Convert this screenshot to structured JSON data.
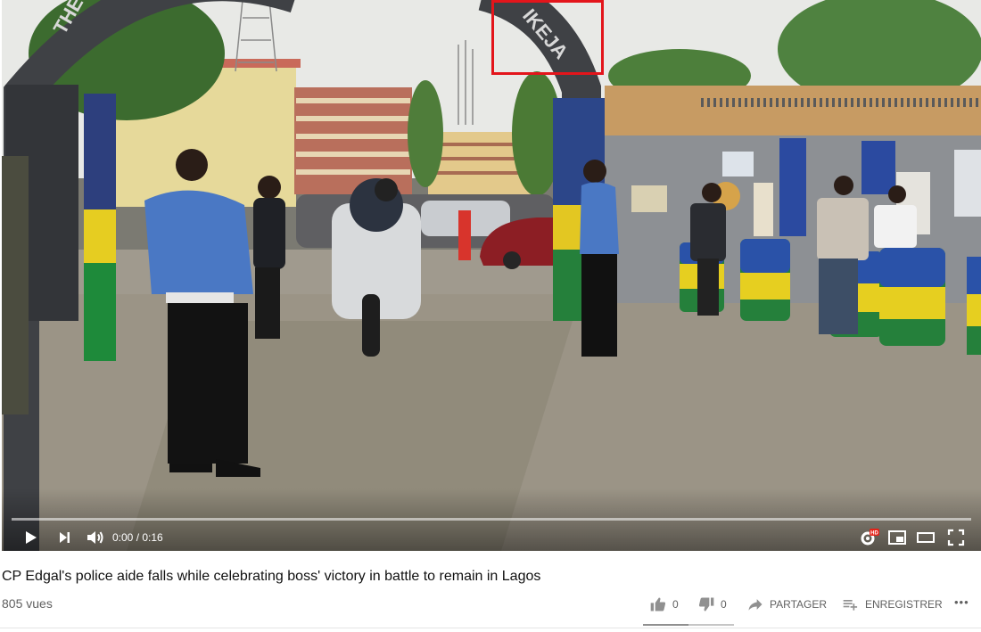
{
  "video": {
    "arch_text_left": "THE",
    "arch_text_right": "IKEJA",
    "time_display": "0:00 / 0:16",
    "progress_fraction": 0,
    "hd_badge": "HD"
  },
  "info": {
    "title": "CP Edgal's police aide falls while celebrating boss' victory in battle to remain in Lagos",
    "views": "805 vues"
  },
  "actions": {
    "likes": "0",
    "dislikes": "0",
    "share_label": "PARTAGER",
    "save_label": "ENREGISTRER",
    "more_label": "•••"
  },
  "colors": {
    "highlight": "#e3151b",
    "sky": "#e8e9e6",
    "ground": "#9e978b",
    "police_blue": "#4a78c4",
    "barrel_yellow": "#e8d21e",
    "barrel_green": "#1f8f3c"
  }
}
